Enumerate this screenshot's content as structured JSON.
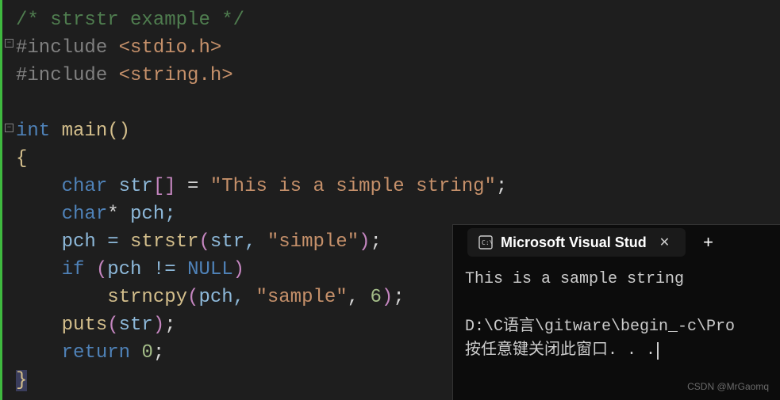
{
  "code": {
    "comment": "/* strstr example */",
    "inc1_pre": "#include ",
    "inc1_hdr": "<stdio.h>",
    "inc2_pre": "#include ",
    "inc2_hdr": "<string.h>",
    "kw_int": "int",
    "fn_main": " main",
    "paren_open": "(",
    "paren_close": ")",
    "brace_open": "{",
    "kw_char1": "char",
    "str_decl": " str",
    "bracket_open": "[",
    "bracket_close": "]",
    "eq": " = ",
    "str_literal": "\"This is a simple string\"",
    "semi": ";",
    "kw_char2": "char",
    "star": "*",
    "pch_decl": " pch;",
    "pch_assign": "pch = ",
    "fn_strstr": "strstr",
    "args_strstr_open": "(",
    "arg_str": "str, ",
    "str_simple": "\"simple\"",
    "args_strstr_close": ")",
    "kw_if": "if ",
    "if_open": "(",
    "pch_ne": "pch != ",
    "null": "NULL",
    "if_close": ")",
    "fn_strncpy": "strncpy",
    "sn_open": "(",
    "pch_arg": "pch, ",
    "str_sample": "\"sample\"",
    "comma_six": ", ",
    "num_six": "6",
    "sn_close": ")",
    "fn_puts": "puts",
    "puts_open": "(",
    "puts_arg": "str",
    "puts_close": ")",
    "kw_return": "return ",
    "num_zero": "0",
    "brace_close": "}"
  },
  "terminal": {
    "title": "Microsoft Visual Stud",
    "output_line1": "This is a sample string",
    "output_line2": "",
    "output_line3": "D:\\C语言\\gitware\\begin_-c\\Pro",
    "output_line4": "按任意键关闭此窗口. . ."
  },
  "watermark": "CSDN @MrGaomq"
}
